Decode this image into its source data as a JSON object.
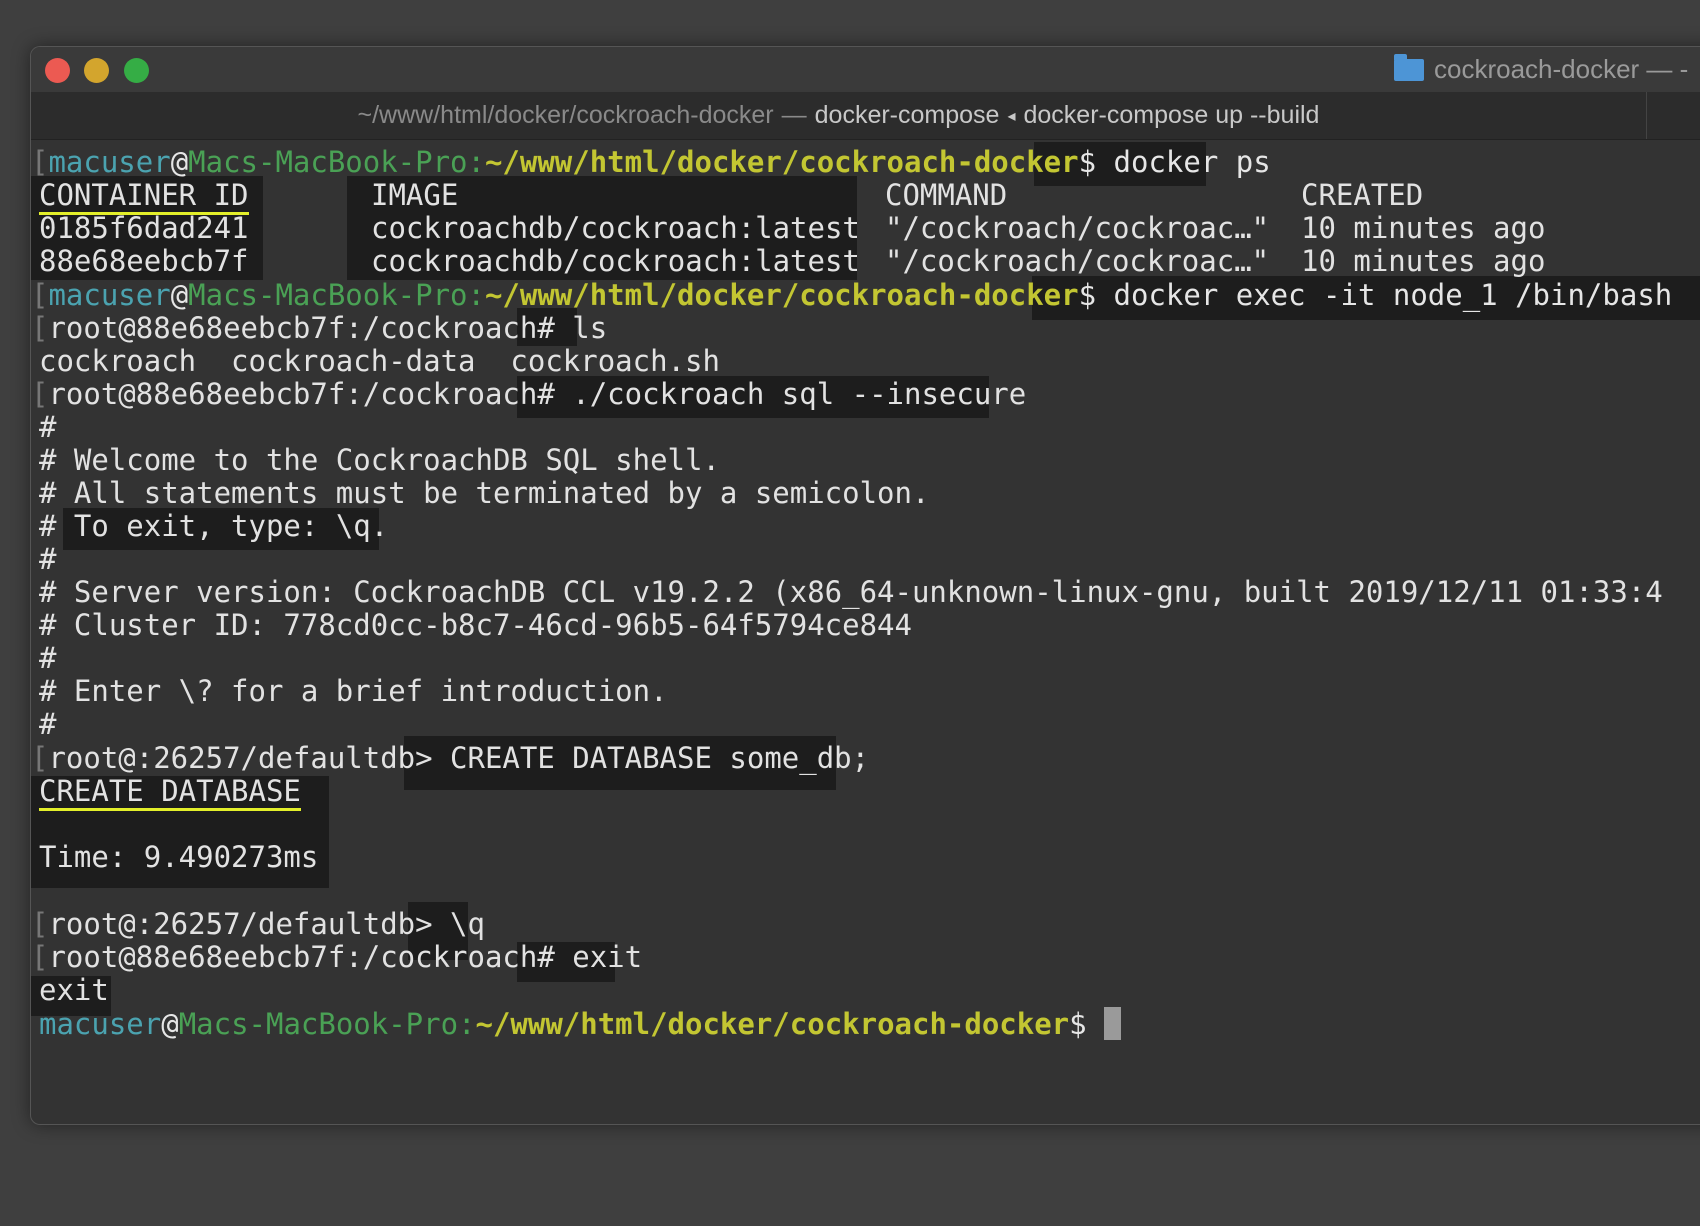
{
  "window": {
    "title": "cockroach-docker — -",
    "folder_icon": "folder-icon",
    "tab": {
      "path": "~/www/html/docker/cockroach-docker",
      "separator": "—",
      "process": "docker-compose",
      "arrow": "◂",
      "command": "docker-compose up --build"
    }
  },
  "prompt": {
    "user": "macuser",
    "at": "@",
    "host": "Macs-MacBook-Pro:",
    "path": "~/www/html/docker/cockroach-docker",
    "dollar": "$"
  },
  "commands": {
    "docker_ps": "docker ps",
    "docker_exec": "docker exec -it node_1 /bin/bash",
    "ls": "ls",
    "sql": "./cockroach sql --insecure",
    "create_db": "CREATE DATABASE some_db;",
    "quit": "\\q",
    "exit": "exit"
  },
  "docker_ps_table": {
    "headers": [
      "CONTAINER ID",
      "IMAGE",
      "COMMAND",
      "CREATED"
    ],
    "rows": [
      [
        "0185f6dad241",
        "cockroachdb/cockroach:latest",
        "\"/cockroach/cockroac…\"",
        "10 minutes ago"
      ],
      [
        "88e68eebcb7f",
        "cockroachdb/cockroach:latest",
        "\"/cockroach/cockroac…\"",
        "10 minutes ago"
      ]
    ]
  },
  "root_prompt": "root@88e68eebcb7f:/cockroach#",
  "ls_output": "cockroach  cockroach-data  cockroach.sh",
  "sql_banner": [
    "#",
    "# Welcome to the CockroachDB SQL shell.",
    "# All statements must be terminated by a semicolon.",
    "# ",
    "#",
    "# Server version: CockroachDB CCL v19.2.2 (x86_64-unknown-linux-gnu, built 2019/12/11 01:33:4",
    "# Cluster ID: 778cd0cc-b8c7-46cd-96b5-64f5794ce844",
    "#",
    "# Enter \\? for a brief introduction.",
    "#"
  ],
  "sql_exit_hint": "To exit, type: \\q.",
  "sql_prompt": "root@:26257/defaultdb>",
  "create_result": "CREATE DATABASE",
  "time_result": "Time: 9.490273ms",
  "exit_output": "exit"
}
